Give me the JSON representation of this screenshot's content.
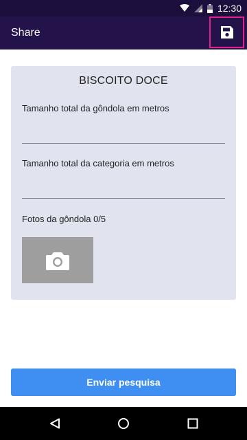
{
  "status_bar": {
    "time": "12:30",
    "icons": [
      "wifi-icon",
      "signal-icon",
      "battery-icon"
    ]
  },
  "app_bar": {
    "title": "Share",
    "save_icon": "save-icon"
  },
  "form": {
    "title": "BISCOITO DOCE",
    "fields": [
      {
        "label": "Tamanho total da gôndola em metros",
        "value": ""
      },
      {
        "label": "Tamanho total da categoria em metros",
        "value": ""
      }
    ],
    "photos_label": "Fotos da gôndola 0/5",
    "photo_icon": "camera-icon"
  },
  "submit_label": "Enviar pesquisa",
  "nav": {
    "icons": [
      "back-icon",
      "home-icon",
      "recents-icon"
    ]
  },
  "colors": {
    "app_bar": "#24134a",
    "status_bar": "#1c0f3d",
    "card": "#e1e4ee",
    "button": "#3f8ef2",
    "highlight": "#e0218a"
  }
}
